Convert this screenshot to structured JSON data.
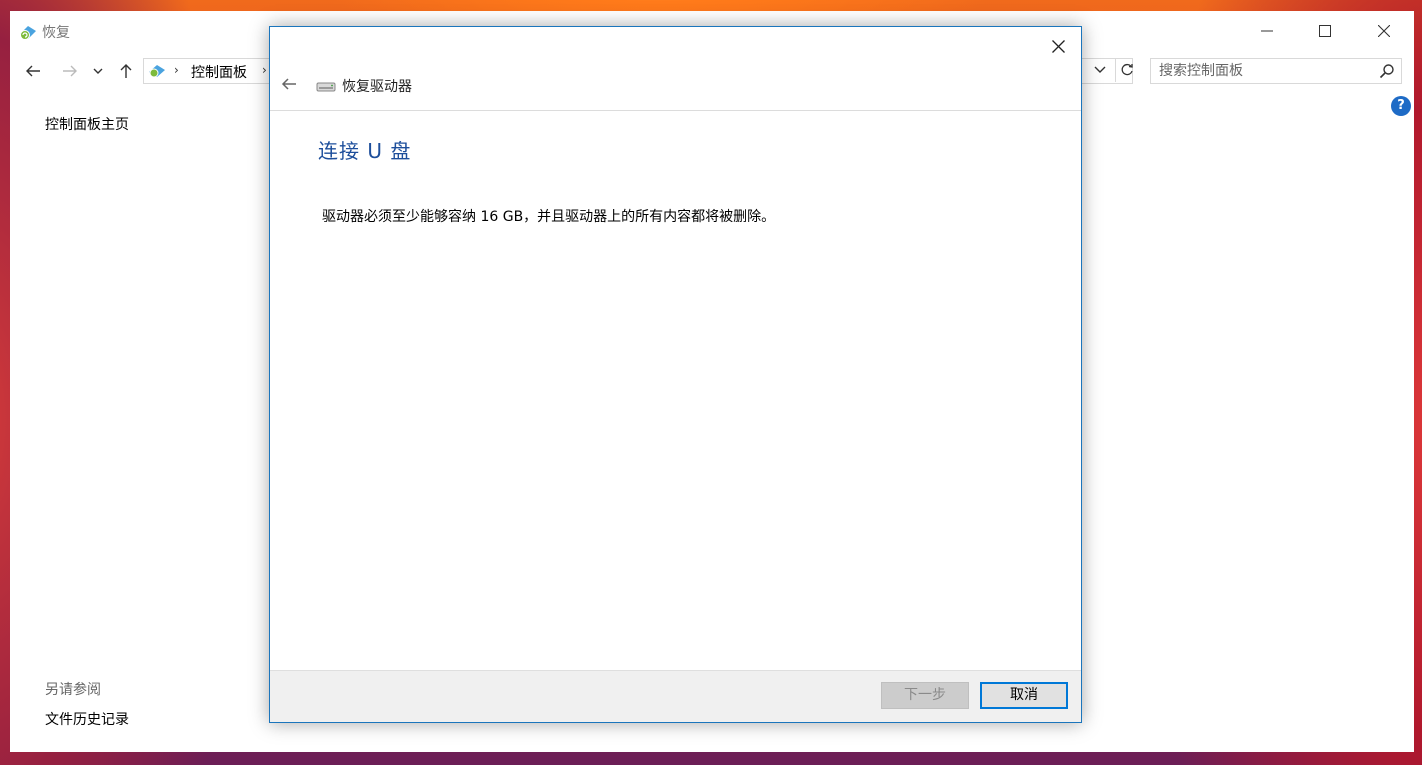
{
  "window": {
    "title": "恢复",
    "breadcrumb": {
      "item": "控制面板"
    },
    "search": {
      "placeholder": "搜索控制面板"
    },
    "help_label": "?"
  },
  "left_nav": {
    "home_link": "控制面板主页",
    "see_also_label": "另请参阅",
    "file_history_link": "文件历史记录"
  },
  "dialog": {
    "title": "恢复驱动器",
    "heading": "连接 U 盘",
    "body": "驱动器必须至少能够容纳 16 GB，并且驱动器上的所有内容都将被删除。",
    "next_button": "下一步",
    "cancel_button": "取消"
  },
  "colors": {
    "accent": "#0078d7",
    "heading": "#1d4e9b",
    "help": "#1e6bc6"
  },
  "icons": [
    "recovery-icon",
    "back-arrow-icon",
    "forward-arrow-icon",
    "chevron-down-icon",
    "up-arrow-icon",
    "refresh-icon",
    "search-icon",
    "close-icon",
    "minimize-icon",
    "maximize-icon",
    "drive-icon",
    "help-icon"
  ]
}
